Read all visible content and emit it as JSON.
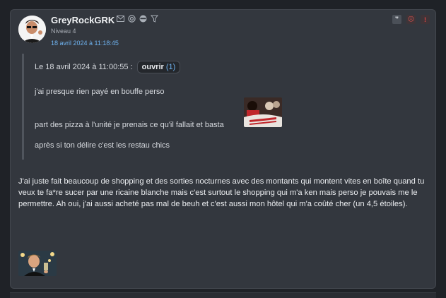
{
  "post": {
    "author": "GreyRockGRK",
    "level": "Niveau 4",
    "date": "18 avril 2024 à 11:18:45",
    "author_icons": [
      "mail-icon",
      "at-icon",
      "ninja-icon",
      "filter-icon"
    ],
    "actions": [
      {
        "name": "quote-icon",
        "label": "❞"
      },
      {
        "name": "sad-face-icon",
        "label": "☹"
      },
      {
        "name": "alert-icon",
        "label": "!"
      }
    ],
    "quote": {
      "header": "Le 18 avril 2024 à 11:00:55 :",
      "open_label": "ouvrir",
      "open_count": "(1)",
      "lines": [
        "j'ai presque rien payé en bouffe perso",
        "part des pizza à l'unité je prenais ce qu'il fallait et basta",
        "après si ton délire c'est les restau chics"
      ]
    },
    "body": "J'ai juste fait beaucoup de shopping et des sorties nocturnes avec des montants qui montent vites en boîte quand tu veux te fa*re sucer par une ricaine blanche mais c'est surtout le shopping qui m'a ken mais perso je pouvais me le permettre. Ah oui, j'ai aussi acheté pas mal de beuh et c'est aussi mon hôtel qui m'a coûté cher (un 4,5 étoiles)."
  },
  "colors": {
    "background": "#1f2227",
    "card": "#33373e",
    "link_blue": "#6fb3f0",
    "alert_red": "#e04343"
  }
}
